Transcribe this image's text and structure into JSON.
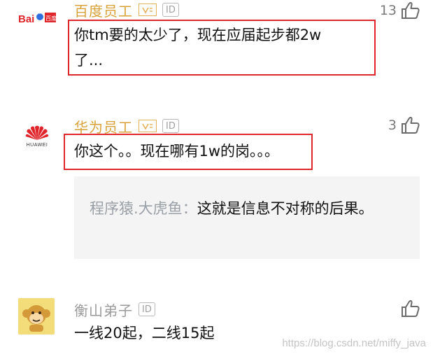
{
  "comments": [
    {
      "author": "百度员工",
      "id_badge": "ID",
      "likes": "13",
      "text_line1": "你tm要的太少了，现在应届起步都2w",
      "text_line2": "了...",
      "avatar": "baidu-logo"
    },
    {
      "author": "华为员工",
      "id_badge": "ID",
      "likes": "3",
      "text": "你这个。。现在哪有1w的岗。。。",
      "avatar": "huawei-logo",
      "avatar_label": "HUAWEI",
      "quote": {
        "author": "程序猿.大虎鱼",
        "separator": "：",
        "text": "这就是信息不对称的后果。"
      }
    },
    {
      "author": "衡山弟子",
      "id_badge": "ID",
      "likes": "",
      "text": "一线20起，二线15起",
      "avatar": "monkey-avatar"
    }
  ],
  "watermark": "https://blog.csdn.net/miffy_java",
  "colors": {
    "highlight_box": "#e0262b",
    "author_gold": "#d9a13a"
  }
}
